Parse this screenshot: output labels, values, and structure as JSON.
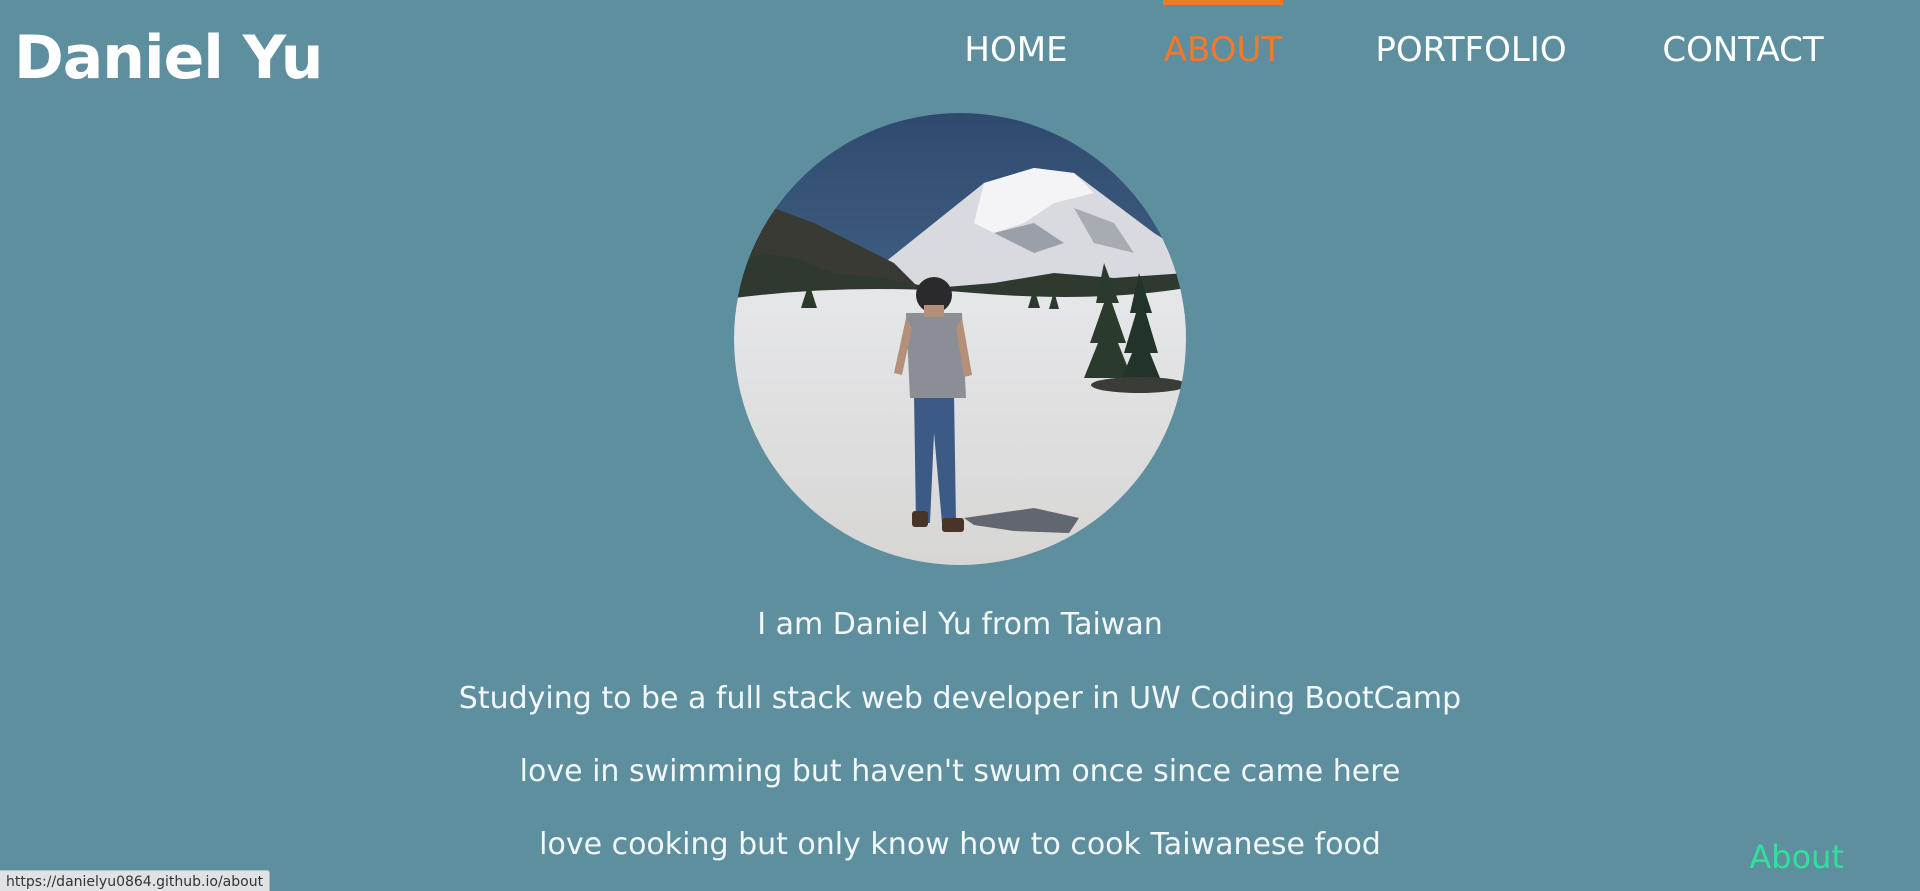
{
  "brand": {
    "name": "Daniel Yu"
  },
  "nav": {
    "items": [
      {
        "label": "HOME",
        "active": false
      },
      {
        "label": "ABOUT",
        "active": true
      },
      {
        "label": "PORTFOLIO",
        "active": false
      },
      {
        "label": "CONTACT",
        "active": false
      }
    ],
    "active_color": "#f07a2a",
    "text_color": "#ffffff"
  },
  "profile": {
    "image_description_icon": "profile-photo-mountain-snow"
  },
  "bio": {
    "lines": [
      "I am Daniel Yu from Taiwan",
      "Studying to be a full stack web developer in UW Coding BootCamp",
      "love in swimming but haven't swum once since came here",
      "love cooking but only know how to cook Taiwanese food"
    ]
  },
  "corner_link": {
    "label": "About",
    "color": "#2de39a"
  },
  "status_bar": {
    "url": "https://danielyu0864.github.io/about"
  },
  "colors": {
    "background": "#5e8f9e"
  }
}
